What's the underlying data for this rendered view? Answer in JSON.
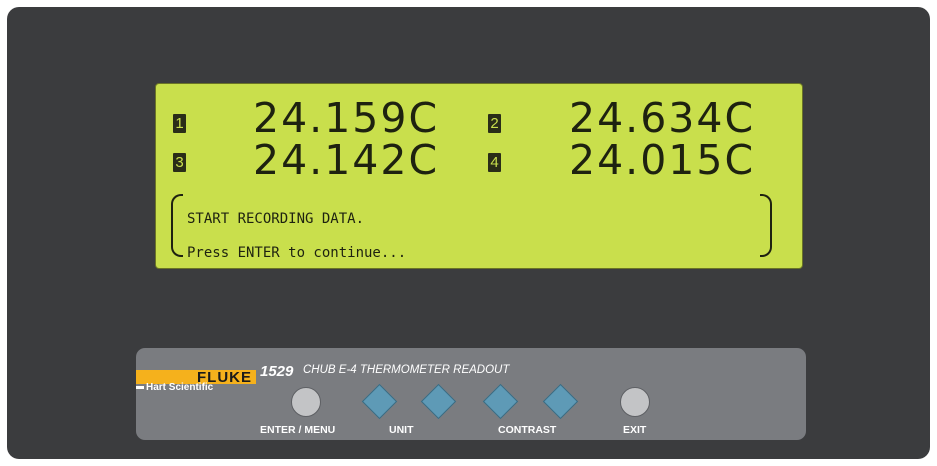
{
  "display": {
    "channels": [
      {
        "number": "1",
        "reading": "24.159C"
      },
      {
        "number": "2",
        "reading": "24.634C"
      },
      {
        "number": "3",
        "reading": "24.142C"
      },
      {
        "number": "4",
        "reading": "24.015C"
      }
    ],
    "message": {
      "line1": "START RECORDING DATA.",
      "line2": "Press ENTER to continue..."
    }
  },
  "panel": {
    "brand": "FLUKE",
    "sub_brand": "Hart Scientific",
    "model_number": "1529",
    "model_title": "CHUB E-4 THERMOMETER READOUT",
    "buttons": {
      "enter_label": "ENTER / MENU",
      "unit_label": "UNIT",
      "contrast_label": "CONTRAST",
      "exit_label": "EXIT"
    }
  },
  "colors": {
    "lcd_background": "#c9df4c",
    "device_body": "#3b3c3e",
    "panel": "#7a7c80",
    "brand_accent": "#f5b11c",
    "arrow_button": "#5e9ab6"
  },
  "icons": {
    "unit_down": "diamond-left-icon",
    "unit_up": "diamond-right-icon",
    "contrast_down": "diamond-left-icon",
    "contrast_up": "diamond-right-icon"
  }
}
